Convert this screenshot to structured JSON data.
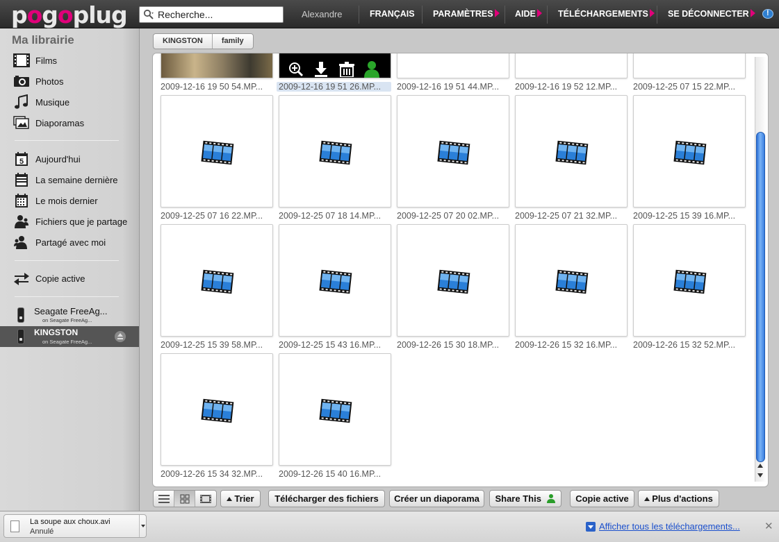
{
  "app": {
    "logo_a": "p",
    "logo_o1": "o",
    "logo_b": "g",
    "logo_o2": "o",
    "logo_c": "plug"
  },
  "search": {
    "placeholder": "Recherche..."
  },
  "nav": {
    "user": "Alexandre",
    "items": [
      "FRANÇAIS",
      "PARAMÈTRES",
      "AIDE",
      "TÉLÉCHARGEMENTS",
      "SE DÉCONNECTER"
    ]
  },
  "sidebar": {
    "title": "Ma librairie",
    "library": [
      "Films",
      "Photos",
      "Musique",
      "Diaporamas"
    ],
    "time": [
      "Aujourd'hui",
      "La semaine dernière",
      "Le mois dernier",
      "Fichiers que je partage",
      "Partagé avec moi"
    ],
    "today_num": "5",
    "copy": "Copie active",
    "devices": [
      {
        "name": "Seagate FreeAg...",
        "sub": "on Seagate FreeAg..."
      },
      {
        "name": "KINGSTON",
        "sub": "on Seagate FreeAg..."
      }
    ]
  },
  "breadcrumb": [
    "KINGSTON",
    "family"
  ],
  "files": [
    "2009-12-16 19 50 54.MP...",
    "2009-12-16 19 51 26.MP...",
    "2009-12-16 19 51 44.MP...",
    "2009-12-16 19 52 12.MP...",
    "2009-12-25 07 15 22.MP...",
    "2009-12-25 07 16 22.MP...",
    "2009-12-25 07 18 14.MP...",
    "2009-12-25 07 20 02.MP...",
    "2009-12-25 07 21 32.MP...",
    "2009-12-25 15 39 16.MP...",
    "2009-12-25 15 39 58.MP...",
    "2009-12-25 15 43 16.MP...",
    "2009-12-26 15 30 18.MP...",
    "2009-12-26 15 32 16.MP...",
    "2009-12-26 15 32 52.MP...",
    "2009-12-26 15 34 32.MP...",
    "2009-12-26 15 40 16.MP..."
  ],
  "toolbar": {
    "sort": "Trier",
    "download": "Télécharger des fichiers",
    "slideshow": "Créer un diaporama",
    "share": "Share This",
    "copy": "Copie active",
    "more": "Plus d'actions"
  },
  "downloads": {
    "file": "La soupe aux choux.avi",
    "state": "Annulé",
    "show_all": "Afficher tous les téléchargements..."
  },
  "colors": {
    "accent": "#e0007a",
    "link": "#1a4fcc",
    "scroll": "#3a7fe0"
  }
}
